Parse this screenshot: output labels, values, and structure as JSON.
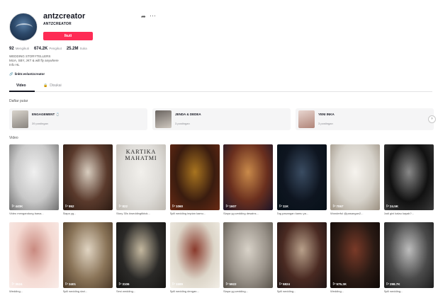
{
  "profile": {
    "username": "antzcreator",
    "nickname": "ANTZCREATOR",
    "follow_label": "Ikuti",
    "share_icon": "share-icon",
    "more_icon": "more-icon",
    "stats": [
      {
        "value": "92",
        "label": "Mengikuti"
      },
      {
        "value": "674.2K",
        "label": "Pengikut"
      },
      {
        "value": "25.2M",
        "label": "Suka"
      }
    ],
    "bio_lines": [
      "WEDDING STORYTELLERS",
      "MUA, SBY, JKT & will fly anywhere",
      "Info HL"
    ],
    "link": "linktr.ee/antzcreator",
    "accent_color": "#fe2c55"
  },
  "tabs": [
    {
      "label": "Video",
      "active": true
    },
    {
      "label": "Disukai",
      "active": false,
      "icon": "lock-icon"
    }
  ],
  "playlists_title": "Daftar putar",
  "playlists": [
    {
      "title": "ENGAGEMENT",
      "subtitle": "39 postingan"
    },
    {
      "title": "JENDA & DEDEA",
      "subtitle": "3 postingan"
    },
    {
      "title": "YENI INKA",
      "subtitle": "3 postingan"
    }
  ],
  "videos_title": "Video",
  "videos": [
    {
      "views": "440K",
      "caption": "Video mengandung bawa...",
      "colors": [
        "#c8c8c8",
        "#f0f0f0",
        "#707070"
      ]
    },
    {
      "views": "952",
      "caption": "Siapa yg...",
      "colors": [
        "#5a3a2c",
        "#d8cdbf",
        "#2a1a12"
      ]
    },
    {
      "views": "822",
      "caption": "Story 30s #weddingtiktok...",
      "colors": [
        "#dedcd8",
        "#f2f0ec",
        "#bdb8b0"
      ],
      "text": "KARTIKA MAHATMI"
    },
    {
      "views": "1060",
      "caption": "Spill wedding impian kamu...",
      "colors": [
        "#3a1c0f",
        "#a8741f",
        "#6a2a14"
      ]
    },
    {
      "views": "1607",
      "caption": "Siapa yg wedding desains...",
      "colors": [
        "#6a2f1e",
        "#c98a4a",
        "#1a1428"
      ]
    },
    {
      "views": "11K",
      "caption": "Tag pasangan kamu ya...",
      "colors": [
        "#0e1520",
        "#3a4c62",
        "#061018"
      ]
    },
    {
      "views": "7067",
      "caption": "Wonderful @pasangan2...",
      "colors": [
        "#d6d2ca",
        "#f6f3ee",
        "#9a8f80"
      ]
    },
    {
      "views": "24.5K",
      "caption": "Jadi gini kalau kayak?...",
      "colors": [
        "#111111",
        "#888888",
        "#3a3a3a"
      ]
    },
    {
      "views": "3524",
      "caption": "Wedding...",
      "colors": [
        "#f4d9d2",
        "#c98a80",
        "#f9ece8"
      ]
    },
    {
      "views": "3401",
      "caption": "Spill wedding dari...",
      "colors": [
        "#8a7458",
        "#e0d4c2",
        "#4a3826"
      ]
    },
    {
      "views": "3106",
      "caption": "Sesi wedding...",
      "colors": [
        "#2b2a28",
        "#c4b89f",
        "#151412"
      ]
    },
    {
      "views": "1589",
      "caption": "Spill wedding dengan...",
      "colors": [
        "#dcd5c8",
        "#8a3a2c",
        "#f2eee6"
      ]
    },
    {
      "views": "5922",
      "caption": "Siapa yg wedding...",
      "colors": [
        "#9a938a",
        "#d8d2c8",
        "#58524a"
      ]
    },
    {
      "views": "5824",
      "caption": "Spill wedding...",
      "colors": [
        "#4a2a22",
        "#b8a08a",
        "#1e1414"
      ]
    },
    {
      "views": "575.3K",
      "caption": "Wedding...",
      "colors": [
        "#2a1a14",
        "#7a3a28",
        "#0e0806"
      ]
    },
    {
      "views": "298.7K",
      "caption": "Spill wedding...",
      "colors": [
        "#4a4a4a",
        "#bdbdbd",
        "#1c1c1c"
      ]
    }
  ]
}
